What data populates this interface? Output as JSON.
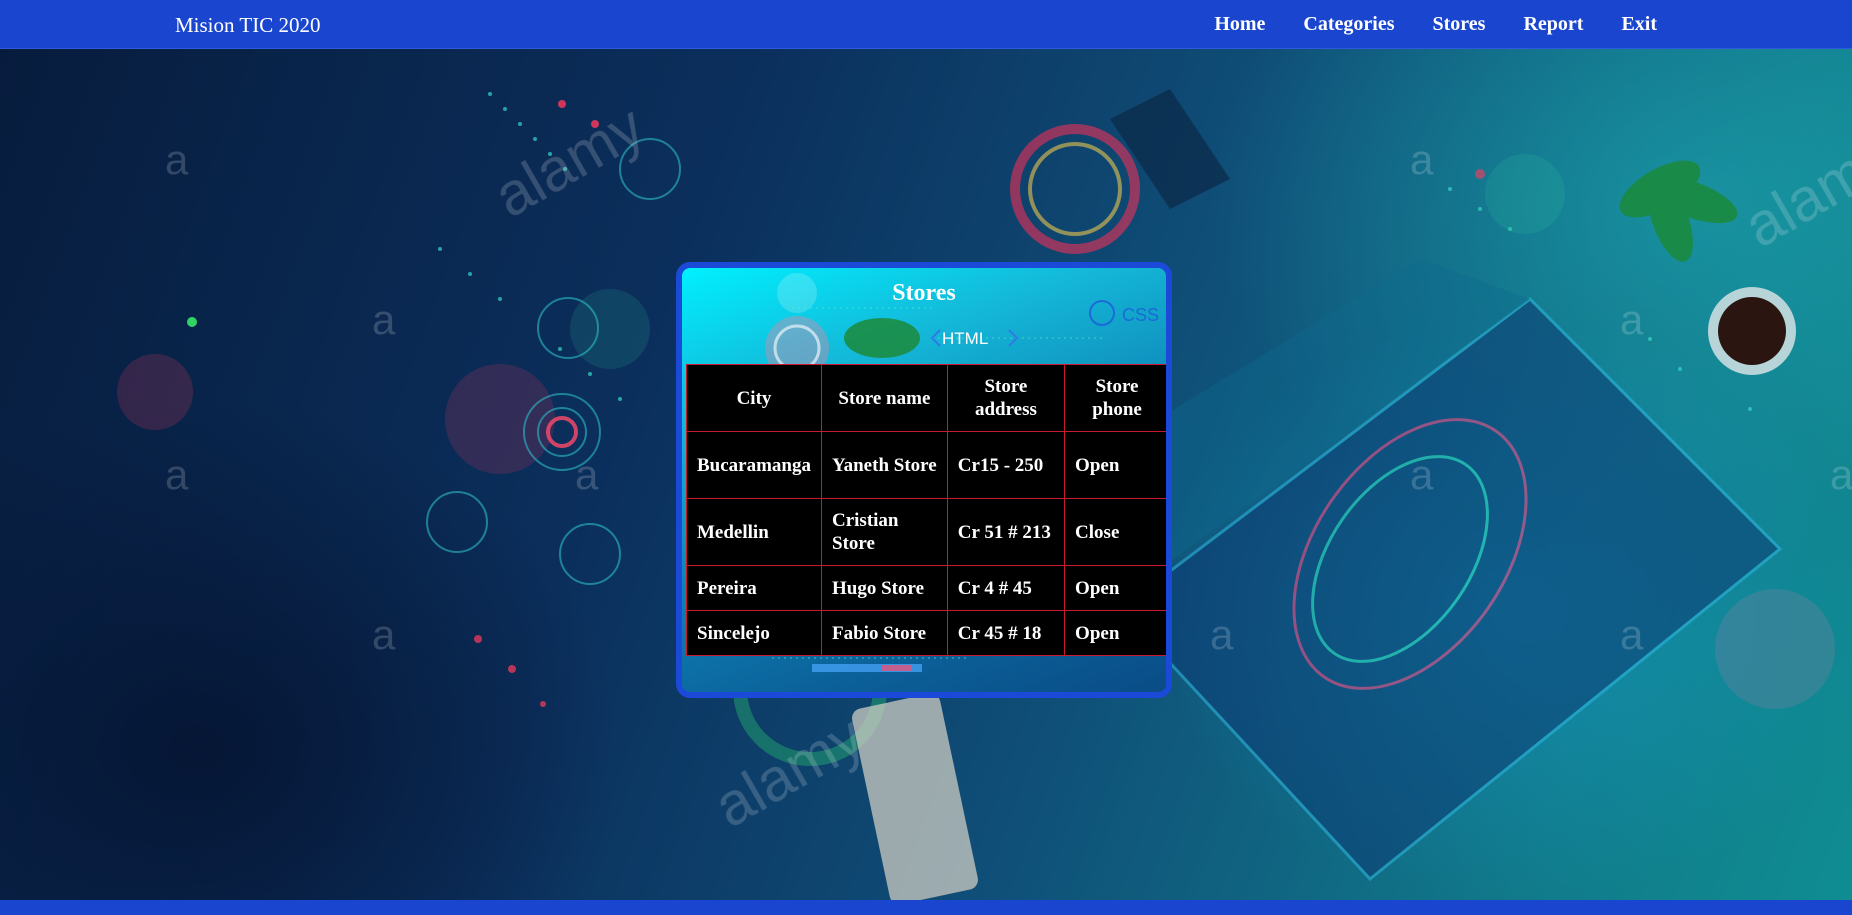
{
  "navbar": {
    "brand": "Mision TIC 2020",
    "links": [
      "Home",
      "Categories",
      "Stores",
      "Report",
      "Exit"
    ],
    "color": "#1a46cf"
  },
  "card": {
    "title": "Stores",
    "deco_labels": {
      "html": "HTML",
      "css": "CSS"
    },
    "border_color": "#1c4ad8"
  },
  "table": {
    "headers": [
      "City",
      "Store name",
      "Store address",
      "Store phone"
    ],
    "rows": [
      [
        "Bucaramanga",
        "Yaneth Store",
        "Cr15 - 250",
        "Open"
      ],
      [
        "Medellin",
        "Cristian Store",
        "Cr 51 # 213",
        "Close"
      ],
      [
        "Pereira",
        "Hugo Store",
        "Cr 4 # 45",
        "Open"
      ],
      [
        "Sincelejo",
        "Fabio Store",
        "Cr 45 # 18",
        "Open"
      ]
    ],
    "border_color": "#c8182a"
  },
  "background": {
    "watermark": "alamy",
    "watermark_letter": "a"
  }
}
